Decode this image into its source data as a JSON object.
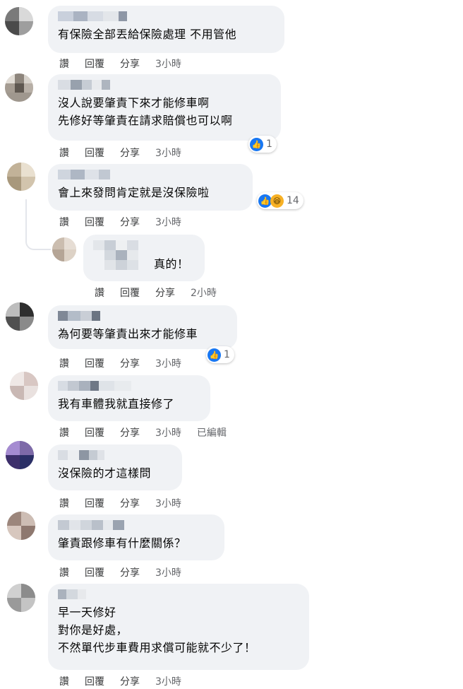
{
  "labels": {
    "like": "讚",
    "reply": "回覆",
    "share": "分享"
  },
  "comments": [
    {
      "text": "有保險全部丟給保險處理 不用管他",
      "time": "3小時"
    },
    {
      "text": "沒人說要肇責下來才能修車啊\n先修好等肇責在請求賠償也可以啊",
      "time": "3小時",
      "reaction_count": "1",
      "reaction_icons": [
        "like-icon"
      ]
    },
    {
      "text": "會上來發問肯定就是沒保險啦",
      "time": "3小時",
      "reaction_count": "14",
      "reaction_icons": [
        "like-icon",
        "haha-icon"
      ]
    },
    {
      "text": "真的！",
      "time": "2小時",
      "is_reply": true
    },
    {
      "text": "為何要等肇責出來才能修車",
      "time": "3小時",
      "reaction_count": "1",
      "reaction_icons": [
        "like-icon"
      ]
    },
    {
      "text": "我有車體我就直接修了",
      "time": "3小時",
      "edited": "已編輯"
    },
    {
      "text": "沒保險的才這樣問",
      "time": "3小時"
    },
    {
      "text": "肇責跟修車有什麼關係？",
      "time": "3小時"
    },
    {
      "text": "早一天修好\n對你是好處，\n不然單代步車費用求償可能就不少了！",
      "time": "3小時"
    }
  ]
}
